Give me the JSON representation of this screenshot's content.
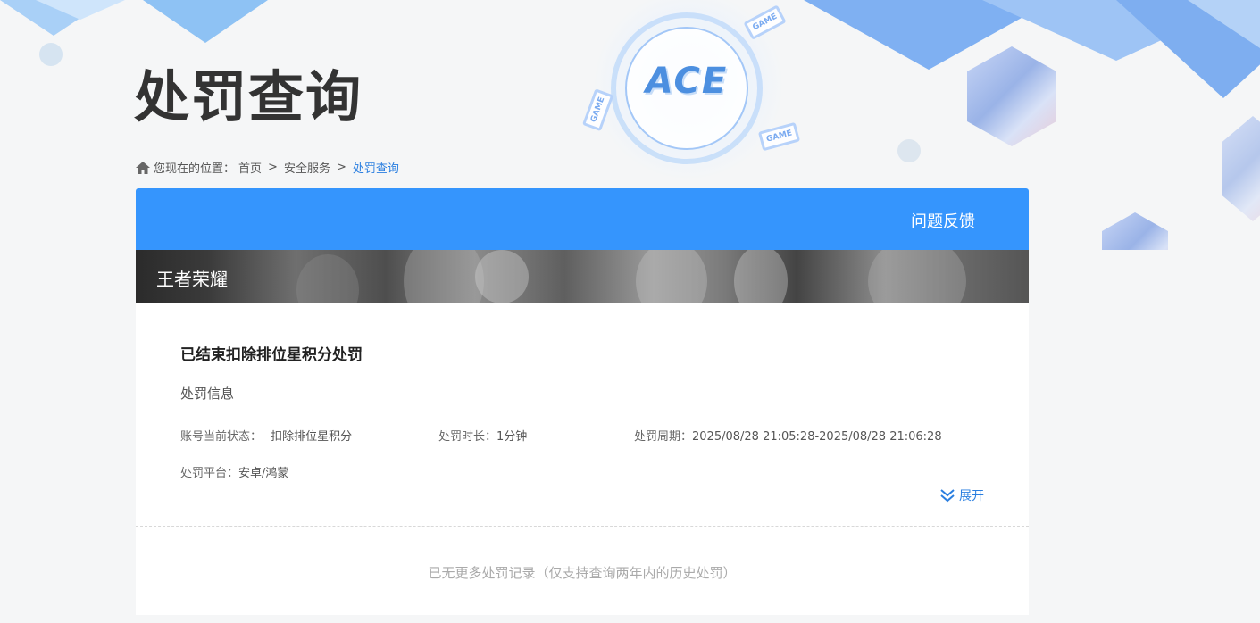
{
  "page": {
    "title": "处罚查询"
  },
  "breadcrumb": {
    "prefix": "您现在的位置：",
    "home": "首页",
    "separator": ">",
    "section": "安全服务",
    "current": "处罚查询"
  },
  "header_logo": {
    "text": "ACE",
    "tags": [
      "GAME",
      "GAME",
      "GAME"
    ]
  },
  "card": {
    "feedback_label": "问题反馈",
    "game_name": "王者荣耀"
  },
  "record": {
    "title": "已结束扣除排位星积分处罚",
    "section_label": "处罚信息",
    "status_key": "账号当前状态：",
    "status_value": "扣除排位星积分",
    "duration_key": "处罚时长：",
    "duration_value": "1分钟",
    "period_key": "处罚周期：",
    "period_value": "2025/08/28 21:05:28-2025/08/28 21:06:28",
    "platform_key": "处罚平台：",
    "platform_value": "安卓/鸿蒙",
    "expand_label": "展开"
  },
  "footer": {
    "no_more_text": "已无更多处罚记录（仅支持查询两年内的历史处罚）"
  },
  "colors": {
    "accent": "#3595fd",
    "link": "#2b7fe0",
    "banner_dark": "#2b2b2b"
  }
}
